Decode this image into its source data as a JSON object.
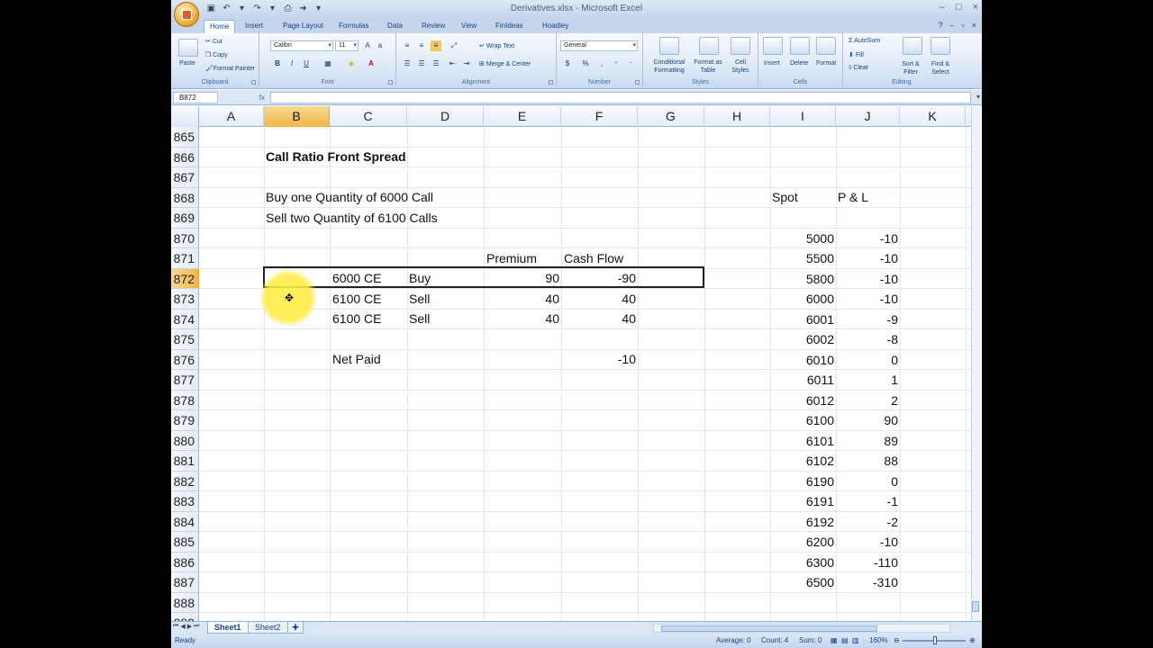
{
  "window": {
    "title": "Derivatives.xlsx - Microsoft Excel",
    "controls": [
      "–",
      "□",
      "×"
    ]
  },
  "tabs": [
    "Home",
    "Insert",
    "Page Layout",
    "Formulas",
    "Data",
    "Review",
    "View",
    "FinIdeas",
    "Hoadley"
  ],
  "ribbon": {
    "clipboard": {
      "label": "Clipboard",
      "paste": "Paste",
      "cut": "Cut",
      "copy": "Copy",
      "format_painter": "Format Painter"
    },
    "font": {
      "label": "Font",
      "name": "Calibri",
      "size": "11",
      "bold": "B",
      "italic": "I",
      "underline": "U"
    },
    "alignment": {
      "label": "Alignment",
      "wrap": "Wrap Text",
      "merge": "Merge & Center"
    },
    "number": {
      "label": "Number",
      "format": "General",
      "currency": "$",
      "percent": "%",
      "comma": ","
    },
    "styles": {
      "label": "Styles",
      "conditional": "Conditional Formatting",
      "format_table": "Format as Table",
      "cell_styles": "Cell Styles"
    },
    "cells": {
      "label": "Cells",
      "insert": "Insert",
      "delete": "Delete",
      "format": "Format"
    },
    "editing": {
      "label": "Editing",
      "autosum": "AutoSum",
      "fill": "Fill",
      "clear": "Clear",
      "sort": "Sort & Filter",
      "find": "Find & Select"
    }
  },
  "formula_bar": {
    "name_box": "B872",
    "fx": "fx",
    "value": ""
  },
  "columns": [
    "A",
    "B",
    "C",
    "D",
    "E",
    "F",
    "G",
    "H",
    "I",
    "J",
    "K"
  ],
  "selected_column": "B",
  "rows": [
    "865",
    "866",
    "867",
    "868",
    "869",
    "870",
    "871",
    "872",
    "873",
    "874",
    "875",
    "876",
    "877",
    "878",
    "879",
    "880",
    "881",
    "882",
    "883",
    "884",
    "885",
    "886",
    "887",
    "888",
    "889"
  ],
  "selected_row": "872",
  "cells": {
    "title": "Call Ratio Front Spread",
    "line1": "Buy one Quantity of 6000 Call",
    "line2": "Sell two Quantity of 6100 Calls",
    "premium_header": "Premium",
    "cashflow_header": "Cash Flow",
    "legs": [
      {
        "option": "6000 CE",
        "action": "Buy",
        "premium": "90",
        "cashflow": "-90"
      },
      {
        "option": "6100 CE",
        "action": "Sell",
        "premium": "40",
        "cashflow": "40"
      },
      {
        "option": "6100 CE",
        "action": "Sell",
        "premium": "40",
        "cashflow": "40"
      }
    ],
    "net_paid_label": "Net Paid",
    "net_paid_value": "-10",
    "spot_header": "Spot",
    "pl_header": "P & L",
    "payoff": [
      {
        "spot": "5000",
        "pl": "-10"
      },
      {
        "spot": "5500",
        "pl": "-10"
      },
      {
        "spot": "5800",
        "pl": "-10"
      },
      {
        "spot": "6000",
        "pl": "-10"
      },
      {
        "spot": "6001",
        "pl": "-9"
      },
      {
        "spot": "6002",
        "pl": "-8"
      },
      {
        "spot": "6010",
        "pl": "0"
      },
      {
        "spot": "6011",
        "pl": "1"
      },
      {
        "spot": "6012",
        "pl": "2"
      },
      {
        "spot": "6100",
        "pl": "90"
      },
      {
        "spot": "6101",
        "pl": "89"
      },
      {
        "spot": "6102",
        "pl": "88"
      },
      {
        "spot": "6190",
        "pl": "0"
      },
      {
        "spot": "6191",
        "pl": "-1"
      },
      {
        "spot": "6192",
        "pl": "-2"
      },
      {
        "spot": "6200",
        "pl": "-10"
      },
      {
        "spot": "6300",
        "pl": "-110"
      },
      {
        "spot": "6500",
        "pl": "-310"
      }
    ]
  },
  "sheets": [
    "Sheet1",
    "Sheet2"
  ],
  "active_sheet": "Sheet1",
  "status": {
    "ready": "Ready",
    "average": "Average: 0",
    "count": "Count: 4",
    "sum": "Sum: 0",
    "zoom": "160%"
  },
  "icons": {
    "office": "office-button-icon",
    "cursor": "cell-cursor-icon"
  }
}
